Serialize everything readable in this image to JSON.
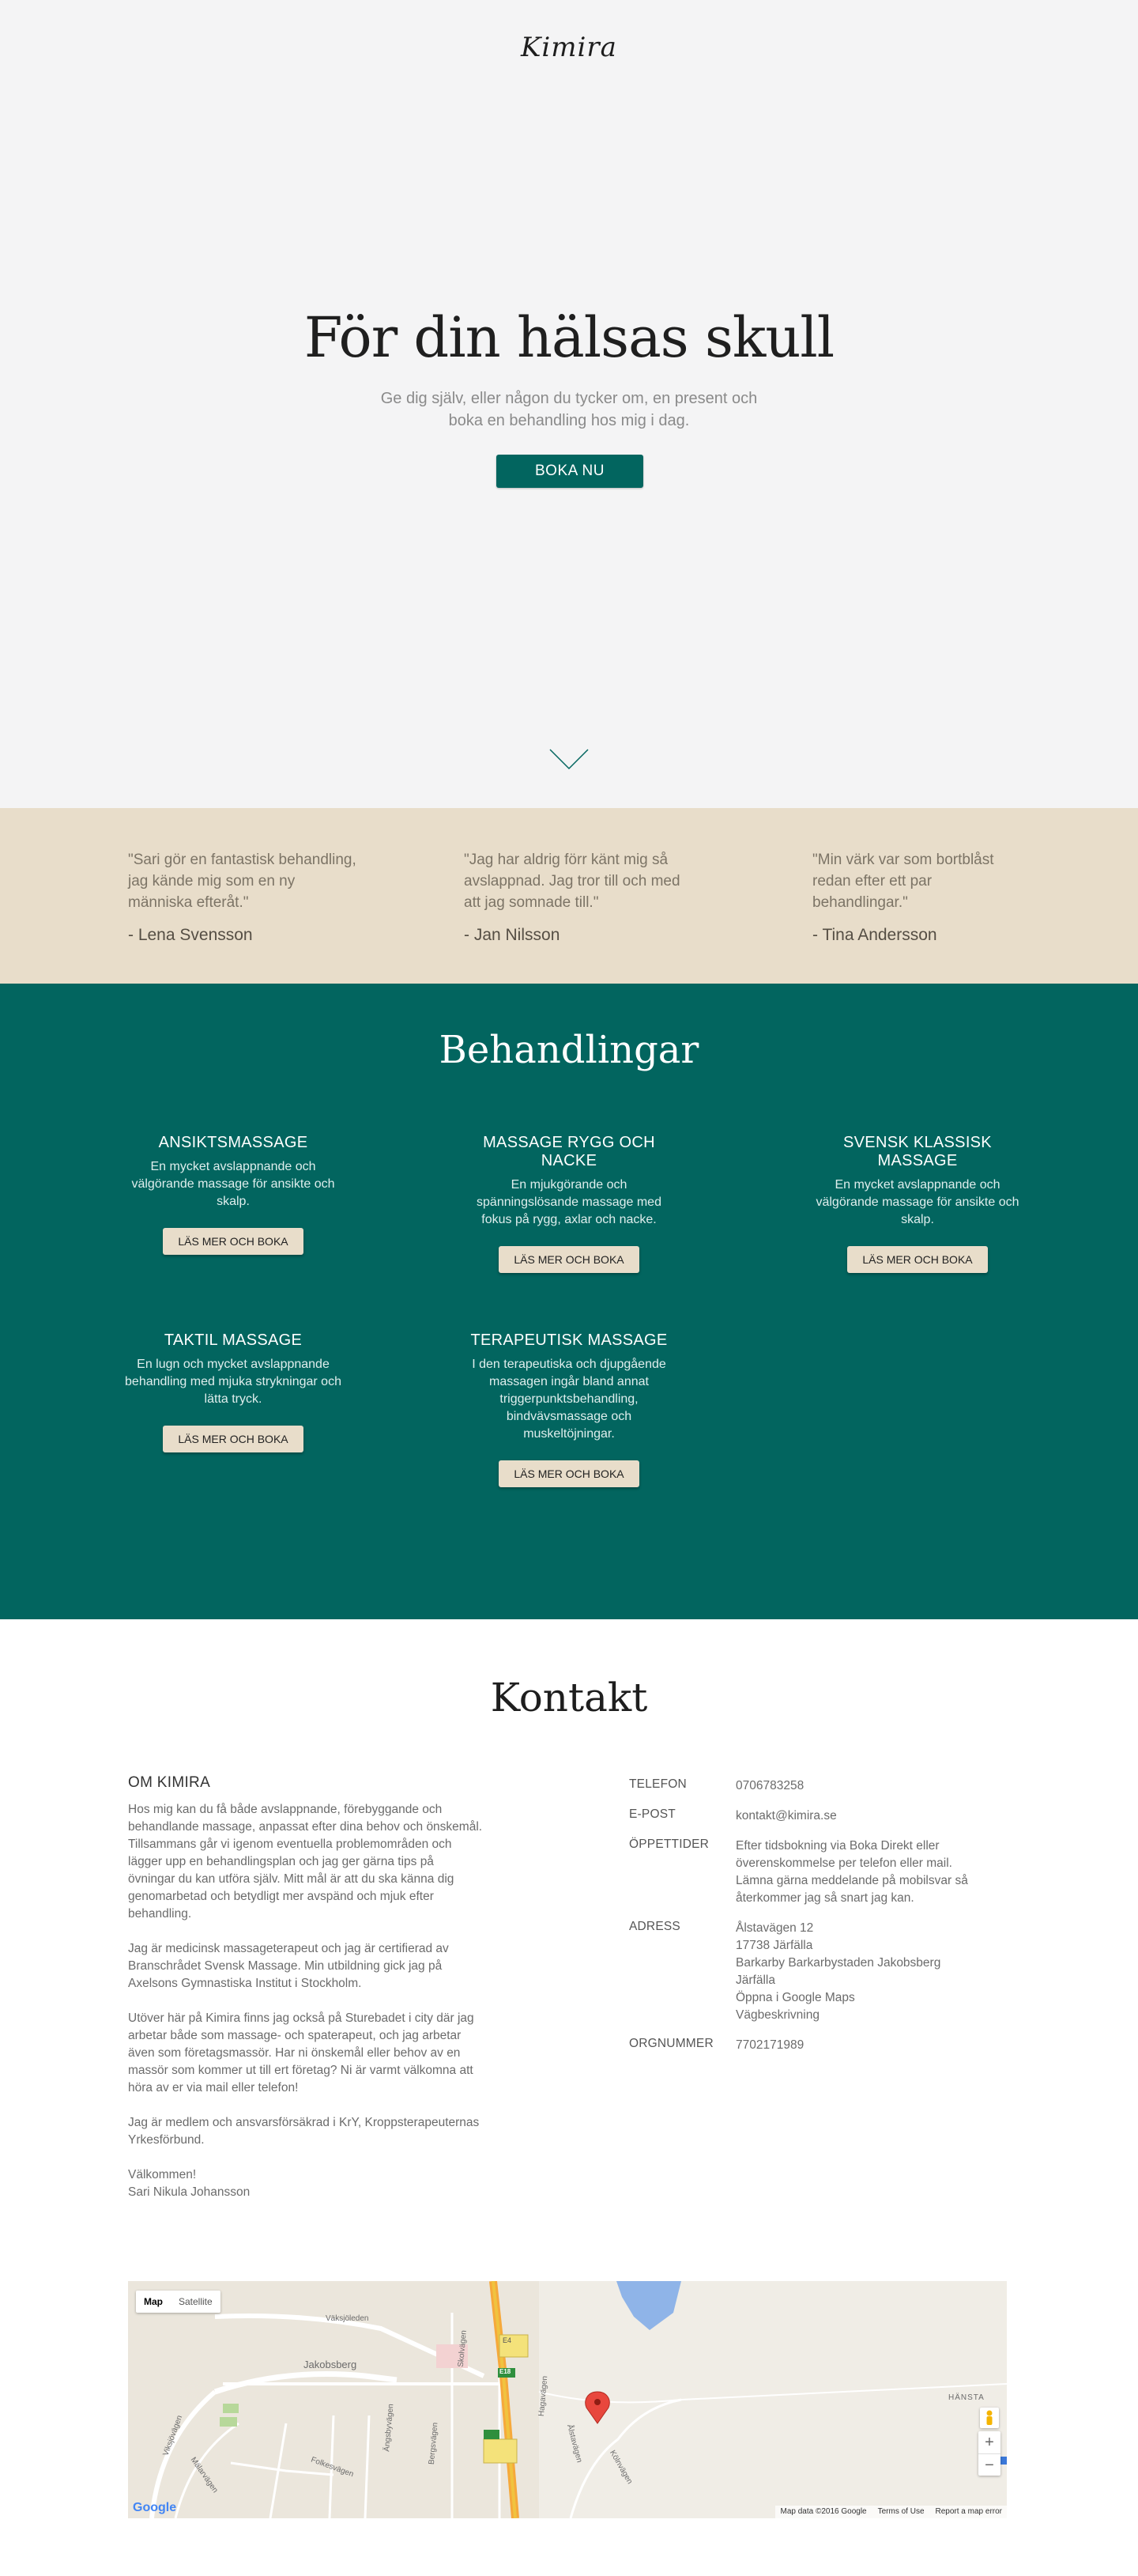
{
  "brand": {
    "logo": "Kimira"
  },
  "hero": {
    "title": "För din hälsas skull",
    "subtitle": "Ge dig själv, eller någon du tycker om, en present och boka en behandling hos mig i dag.",
    "cta": "BOKA NU"
  },
  "testimonials": [
    {
      "quote": "\"Sari gör en fantastisk behandling, jag kände mig som en ny människa efteråt.\"",
      "author": "- Lena Svensson"
    },
    {
      "quote": "\"Jag har aldrig förr känt mig så avslappnad. Jag tror till och med att jag somnade till.\"",
      "author": "- Jan Nilsson"
    },
    {
      "quote": "\"Min värk var som bortblåst redan efter ett par behandlingar.\"",
      "author": "- Tina Andersson"
    }
  ],
  "treatments": {
    "title": "Behandlingar",
    "button_label": "LÄS MER OCH BOKA",
    "items": [
      {
        "name": "ANSIKTSMASSAGE",
        "desc": "En mycket avslappnande och välgörande massage för ansikte och skalp."
      },
      {
        "name": "MASSAGE RYGG OCH NACKE",
        "desc": "En mjukgörande och spänningslösande massage med fokus på rygg, axlar och nacke."
      },
      {
        "name": "SVENSK KLASSISK MASSAGE",
        "desc": "En mycket avslappnande och välgörande massage för ansikte och skalp."
      },
      {
        "name": "TAKTIL MASSAGE",
        "desc": "En lugn och mycket avslappnande behandling med mjuka strykningar och lätta tryck."
      },
      {
        "name": "TERAPEUTISK MASSAGE",
        "desc": "I den terapeutiska och djupgående massagen ingår bland annat triggerpunktsbehandling, bindvävsmassage och muskeltöjningar."
      }
    ]
  },
  "contact": {
    "title": "Kontakt",
    "about_heading": "OM KIMIRA",
    "about_paragraphs": [
      "Hos mig kan du få både avslappnande, förebyggande och behandlande massage, anpassat efter dina behov och önskemål. Tillsammans går vi igenom eventuella problemområden och lägger upp en behandlingsplan och jag ger gärna tips på övningar du kan utföra själv. Mitt mål är att du ska känna dig genomarbetad och betydligt mer avspänd och mjuk efter behandling.",
      "Jag är medicinsk massageterapeut och jag är certifierad av Branschrådet Svensk Massage. Min utbildning gick jag på Axelsons Gymnastiska Institut i Stockholm.",
      "Utöver här på Kimira finns jag också på Sturebadet i city där jag arbetar både som massage- och spaterapeut, och jag arbetar även som företagsmassör. Har ni önskemål eller behov av en massör som kommer ut till ert företag? Ni är varmt välkomna att höra av er via mail eller telefon!",
      "Jag är medlem och ansvarsförsäkrad i KrY, Kroppsterapeuternas Yrkesförbund."
    ],
    "greeting": "Välkommen!",
    "signature": "Sari Nikula Johansson",
    "info": {
      "phone_label": "TELEFON",
      "phone": "0706783258",
      "email_label": "E-POST",
      "email": "kontakt@kimira.se",
      "hours_label": "ÖPPETTIDER",
      "hours": "Efter tidsbokning via Boka Direkt eller överenskommelse per telefon eller mail. Lämna gärna meddelande på mobilsvar så återkommer jag så snart jag kan.",
      "address_label": "ADRESS",
      "address_lines": [
        "Ålstavägen 12",
        "17738 Järfälla",
        "Barkarby Barkarbystaden Jakobsberg",
        "Järfälla"
      ],
      "map_link": "Öppna i Google Maps",
      "directions_link": "Vägbeskrivning",
      "org_label": "ORGNUMMER",
      "org": "7702171989"
    }
  },
  "map": {
    "type_map": "Map",
    "type_satellite": "Satellite",
    "zoom_in": "+",
    "zoom_out": "−",
    "logo": "Google",
    "footer": {
      "data": "Map data ©2016 Google",
      "terms": "Terms of Use",
      "report": "Report a map error"
    },
    "labels": [
      "Jakobsberg",
      "HÄNSTA",
      "Väksjöleden",
      "Viksjövägen",
      "Mälarvägen",
      "Folkesvägen",
      "Ängsbyvägen",
      "Bergsvägen",
      "Skolvägen",
      "Hagavägen",
      "Ålstavägen",
      "Kölnvägen"
    ],
    "shields": [
      "E4",
      "E18"
    ]
  },
  "colors": {
    "teal": "#02655f",
    "beige": "#e8ddca",
    "hero_bg": "#f4f4f5"
  }
}
